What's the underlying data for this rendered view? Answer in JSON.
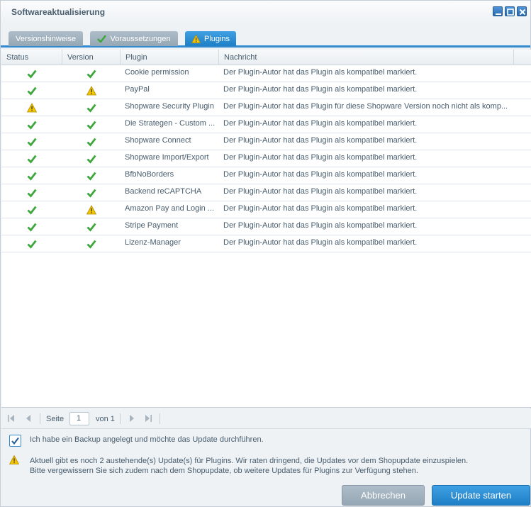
{
  "window": {
    "title": "Softwareaktualisierung"
  },
  "tabs": [
    {
      "label": "Versionshinweise",
      "icon": null,
      "active": false
    },
    {
      "label": "Voraussetzungen",
      "icon": "check-icon",
      "active": false
    },
    {
      "label": "Plugins",
      "icon": "warning-icon",
      "active": true
    }
  ],
  "grid": {
    "columns": [
      "Status",
      "Version",
      "Plugin",
      "Nachricht"
    ],
    "rows": [
      {
        "status": "ok",
        "version": "ok",
        "plugin": "Cookie permission",
        "message": "Der Plugin-Autor hat das Plugin als kompatibel markiert."
      },
      {
        "status": "ok",
        "version": "warning",
        "plugin": "PayPal",
        "message": "Der Plugin-Autor hat das Plugin als kompatibel markiert."
      },
      {
        "status": "warning",
        "version": "ok",
        "plugin": "Shopware Security Plugin",
        "message": "Der Plugin-Autor hat das Plugin für diese Shopware Version noch nicht als komp..."
      },
      {
        "status": "ok",
        "version": "ok",
        "plugin": "Die Strategen - Custom ...",
        "message": "Der Plugin-Autor hat das Plugin als kompatibel markiert."
      },
      {
        "status": "ok",
        "version": "ok",
        "plugin": "Shopware Connect",
        "message": "Der Plugin-Autor hat das Plugin als kompatibel markiert."
      },
      {
        "status": "ok",
        "version": "ok",
        "plugin": "Shopware Import/Export",
        "message": "Der Plugin-Autor hat das Plugin als kompatibel markiert."
      },
      {
        "status": "ok",
        "version": "ok",
        "plugin": "BfbNoBorders",
        "message": "Der Plugin-Autor hat das Plugin als kompatibel markiert."
      },
      {
        "status": "ok",
        "version": "ok",
        "plugin": "Backend reCAPTCHA",
        "message": "Der Plugin-Autor hat das Plugin als kompatibel markiert."
      },
      {
        "status": "ok",
        "version": "warning",
        "plugin": "Amazon Pay and Login ...",
        "message": "Der Plugin-Autor hat das Plugin als kompatibel markiert."
      },
      {
        "status": "ok",
        "version": "ok",
        "plugin": "Stripe Payment",
        "message": "Der Plugin-Autor hat das Plugin als kompatibel markiert."
      },
      {
        "status": "ok",
        "version": "ok",
        "plugin": "Lizenz-Manager",
        "message": "Der Plugin-Autor hat das Plugin als kompatibel markiert."
      }
    ]
  },
  "pager": {
    "page_label": "Seite",
    "page_value": "1",
    "of_label": "von 1"
  },
  "backup": {
    "checked": true,
    "label": "Ich habe ein Backup angelegt und möchte das Update durchführen."
  },
  "notice": {
    "line1": "Aktuell gibt es noch 2 austehende(s) Update(s) für Plugins. Wir raten dringend, die Updates vor dem Shopupdate einzuspielen.",
    "line2": "Bitte vergewissern Sie sich zudem nach dem Shopupdate, ob weitere Updates für Plugins zur Verfügung stehen."
  },
  "buttons": {
    "cancel": "Abbrechen",
    "start": "Update starten"
  },
  "colors": {
    "ok": "#3ea83e",
    "warning": "#f2c500",
    "accent": "#2f8ad0"
  }
}
